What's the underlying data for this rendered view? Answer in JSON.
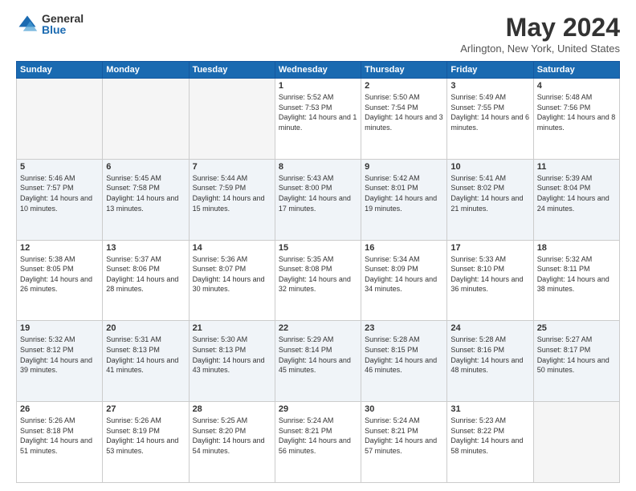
{
  "header": {
    "logo_general": "General",
    "logo_blue": "Blue",
    "month": "May 2024",
    "location": "Arlington, New York, United States"
  },
  "weekdays": [
    "Sunday",
    "Monday",
    "Tuesday",
    "Wednesday",
    "Thursday",
    "Friday",
    "Saturday"
  ],
  "weeks": [
    [
      {
        "day": "",
        "sunrise": "",
        "sunset": "",
        "daylight": ""
      },
      {
        "day": "",
        "sunrise": "",
        "sunset": "",
        "daylight": ""
      },
      {
        "day": "",
        "sunrise": "",
        "sunset": "",
        "daylight": ""
      },
      {
        "day": "1",
        "sunrise": "Sunrise: 5:52 AM",
        "sunset": "Sunset: 7:53 PM",
        "daylight": "Daylight: 14 hours and 1 minute."
      },
      {
        "day": "2",
        "sunrise": "Sunrise: 5:50 AM",
        "sunset": "Sunset: 7:54 PM",
        "daylight": "Daylight: 14 hours and 3 minutes."
      },
      {
        "day": "3",
        "sunrise": "Sunrise: 5:49 AM",
        "sunset": "Sunset: 7:55 PM",
        "daylight": "Daylight: 14 hours and 6 minutes."
      },
      {
        "day": "4",
        "sunrise": "Sunrise: 5:48 AM",
        "sunset": "Sunset: 7:56 PM",
        "daylight": "Daylight: 14 hours and 8 minutes."
      }
    ],
    [
      {
        "day": "5",
        "sunrise": "Sunrise: 5:46 AM",
        "sunset": "Sunset: 7:57 PM",
        "daylight": "Daylight: 14 hours and 10 minutes."
      },
      {
        "day": "6",
        "sunrise": "Sunrise: 5:45 AM",
        "sunset": "Sunset: 7:58 PM",
        "daylight": "Daylight: 14 hours and 13 minutes."
      },
      {
        "day": "7",
        "sunrise": "Sunrise: 5:44 AM",
        "sunset": "Sunset: 7:59 PM",
        "daylight": "Daylight: 14 hours and 15 minutes."
      },
      {
        "day": "8",
        "sunrise": "Sunrise: 5:43 AM",
        "sunset": "Sunset: 8:00 PM",
        "daylight": "Daylight: 14 hours and 17 minutes."
      },
      {
        "day": "9",
        "sunrise": "Sunrise: 5:42 AM",
        "sunset": "Sunset: 8:01 PM",
        "daylight": "Daylight: 14 hours and 19 minutes."
      },
      {
        "day": "10",
        "sunrise": "Sunrise: 5:41 AM",
        "sunset": "Sunset: 8:02 PM",
        "daylight": "Daylight: 14 hours and 21 minutes."
      },
      {
        "day": "11",
        "sunrise": "Sunrise: 5:39 AM",
        "sunset": "Sunset: 8:04 PM",
        "daylight": "Daylight: 14 hours and 24 minutes."
      }
    ],
    [
      {
        "day": "12",
        "sunrise": "Sunrise: 5:38 AM",
        "sunset": "Sunset: 8:05 PM",
        "daylight": "Daylight: 14 hours and 26 minutes."
      },
      {
        "day": "13",
        "sunrise": "Sunrise: 5:37 AM",
        "sunset": "Sunset: 8:06 PM",
        "daylight": "Daylight: 14 hours and 28 minutes."
      },
      {
        "day": "14",
        "sunrise": "Sunrise: 5:36 AM",
        "sunset": "Sunset: 8:07 PM",
        "daylight": "Daylight: 14 hours and 30 minutes."
      },
      {
        "day": "15",
        "sunrise": "Sunrise: 5:35 AM",
        "sunset": "Sunset: 8:08 PM",
        "daylight": "Daylight: 14 hours and 32 minutes."
      },
      {
        "day": "16",
        "sunrise": "Sunrise: 5:34 AM",
        "sunset": "Sunset: 8:09 PM",
        "daylight": "Daylight: 14 hours and 34 minutes."
      },
      {
        "day": "17",
        "sunrise": "Sunrise: 5:33 AM",
        "sunset": "Sunset: 8:10 PM",
        "daylight": "Daylight: 14 hours and 36 minutes."
      },
      {
        "day": "18",
        "sunrise": "Sunrise: 5:32 AM",
        "sunset": "Sunset: 8:11 PM",
        "daylight": "Daylight: 14 hours and 38 minutes."
      }
    ],
    [
      {
        "day": "19",
        "sunrise": "Sunrise: 5:32 AM",
        "sunset": "Sunset: 8:12 PM",
        "daylight": "Daylight: 14 hours and 39 minutes."
      },
      {
        "day": "20",
        "sunrise": "Sunrise: 5:31 AM",
        "sunset": "Sunset: 8:13 PM",
        "daylight": "Daylight: 14 hours and 41 minutes."
      },
      {
        "day": "21",
        "sunrise": "Sunrise: 5:30 AM",
        "sunset": "Sunset: 8:13 PM",
        "daylight": "Daylight: 14 hours and 43 minutes."
      },
      {
        "day": "22",
        "sunrise": "Sunrise: 5:29 AM",
        "sunset": "Sunset: 8:14 PM",
        "daylight": "Daylight: 14 hours and 45 minutes."
      },
      {
        "day": "23",
        "sunrise": "Sunrise: 5:28 AM",
        "sunset": "Sunset: 8:15 PM",
        "daylight": "Daylight: 14 hours and 46 minutes."
      },
      {
        "day": "24",
        "sunrise": "Sunrise: 5:28 AM",
        "sunset": "Sunset: 8:16 PM",
        "daylight": "Daylight: 14 hours and 48 minutes."
      },
      {
        "day": "25",
        "sunrise": "Sunrise: 5:27 AM",
        "sunset": "Sunset: 8:17 PM",
        "daylight": "Daylight: 14 hours and 50 minutes."
      }
    ],
    [
      {
        "day": "26",
        "sunrise": "Sunrise: 5:26 AM",
        "sunset": "Sunset: 8:18 PM",
        "daylight": "Daylight: 14 hours and 51 minutes."
      },
      {
        "day": "27",
        "sunrise": "Sunrise: 5:26 AM",
        "sunset": "Sunset: 8:19 PM",
        "daylight": "Daylight: 14 hours and 53 minutes."
      },
      {
        "day": "28",
        "sunrise": "Sunrise: 5:25 AM",
        "sunset": "Sunset: 8:20 PM",
        "daylight": "Daylight: 14 hours and 54 minutes."
      },
      {
        "day": "29",
        "sunrise": "Sunrise: 5:24 AM",
        "sunset": "Sunset: 8:21 PM",
        "daylight": "Daylight: 14 hours and 56 minutes."
      },
      {
        "day": "30",
        "sunrise": "Sunrise: 5:24 AM",
        "sunset": "Sunset: 8:21 PM",
        "daylight": "Daylight: 14 hours and 57 minutes."
      },
      {
        "day": "31",
        "sunrise": "Sunrise: 5:23 AM",
        "sunset": "Sunset: 8:22 PM",
        "daylight": "Daylight: 14 hours and 58 minutes."
      },
      {
        "day": "",
        "sunrise": "",
        "sunset": "",
        "daylight": ""
      }
    ]
  ]
}
